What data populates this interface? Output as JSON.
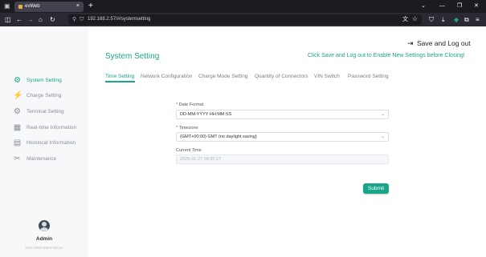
{
  "browser": {
    "tab_title": "evWeb",
    "tab_close": "×",
    "new_tab": "+",
    "url": "192.168.2.57/#/systemsetting",
    "window_controls": {
      "minimize": "—",
      "maximize": "❐",
      "close": "✕"
    },
    "tab_list": "⌄"
  },
  "sidebar": {
    "items": [
      {
        "label": "System Setting",
        "icon": "gear-icon",
        "glyph": "⚙",
        "active": true
      },
      {
        "label": "Charge Setting",
        "icon": "charge-icon",
        "glyph": "⚡",
        "active": false
      },
      {
        "label": "Terminal Setting",
        "icon": "terminal-icon",
        "glyph": "⚙",
        "active": false
      },
      {
        "label": "Real-time Information",
        "icon": "realtime-info-icon",
        "glyph": "▦",
        "active": false
      },
      {
        "label": "Historical Information",
        "icon": "history-icon",
        "glyph": "▤",
        "active": false
      },
      {
        "label": "Maintenance",
        "icon": "maintenance-icon",
        "glyph": "✂",
        "active": false
      }
    ],
    "user": {
      "name": "Admin",
      "mac": "MAC:0904:99F6:OE:0A"
    }
  },
  "header": {
    "title": "System Setting",
    "logout_label": "Save and Log out",
    "hint": "Click Save and Log out to Enable New Settings before Closing!"
  },
  "tabs": [
    {
      "label": "Time Setting",
      "active": true
    },
    {
      "label": "Network Configuration",
      "active": false
    },
    {
      "label": "Charge Mode Setting",
      "active": false
    },
    {
      "label": "Quantity of Connectors",
      "active": false
    },
    {
      "label": "VIN Switch",
      "active": false
    },
    {
      "label": "Password Setting",
      "active": false
    }
  ],
  "form": {
    "date_format": {
      "required_mark": "*",
      "label": "Date Format",
      "value": "DD-MM-YYYY HH:MM:SS"
    },
    "timezone": {
      "required_mark": "*",
      "label": "Timezone",
      "value": "(GMT+00:00) GMT (no daylight saving)"
    },
    "current_time": {
      "label": "Current Time",
      "value": "2025-01-27 08:35:17"
    },
    "submit_label": "Submit"
  },
  "colors": {
    "accent": "#18a58a",
    "required": "#e64a4a",
    "browser_chrome": "#1c1b22"
  }
}
